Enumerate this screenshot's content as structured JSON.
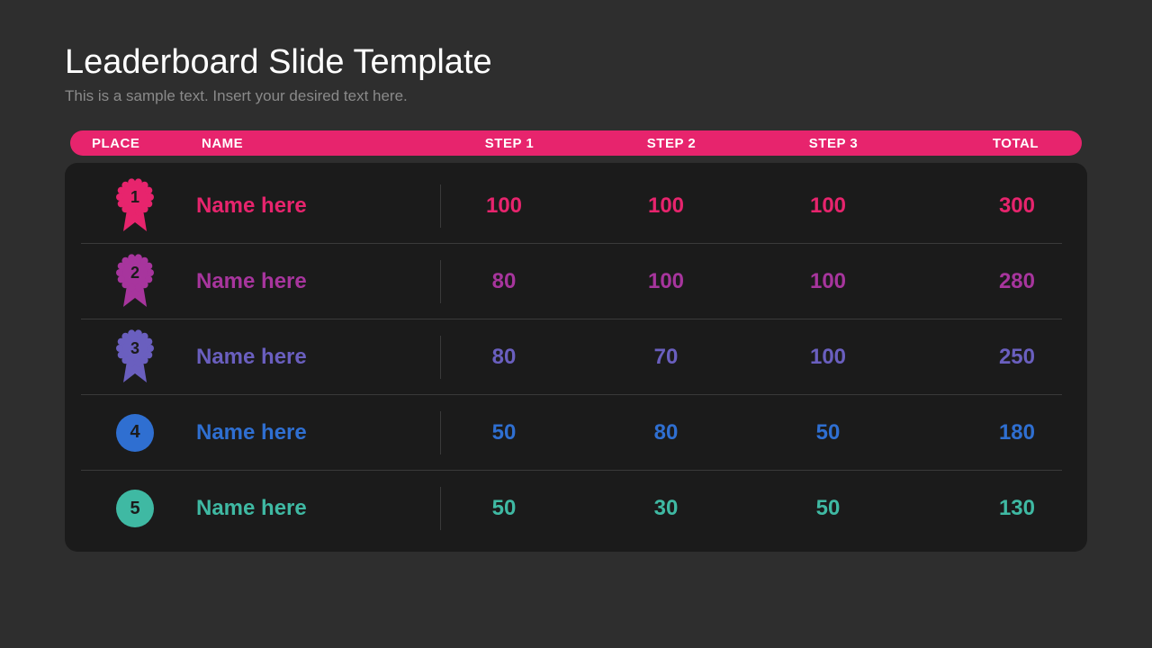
{
  "title": "Leaderboard Slide Template",
  "subtitle": "This is a sample text. Insert your desired text here.",
  "columns": {
    "place": "PLACE",
    "name": "NAME",
    "step1": "STEP 1",
    "step2": "STEP 2",
    "step3": "STEP 3",
    "total": "TOTAL"
  },
  "rows": [
    {
      "place": "1",
      "badge": "ribbon",
      "color": "#e7246d",
      "name": "Name here",
      "step1": "100",
      "step2": "100",
      "step3": "100",
      "total": "300"
    },
    {
      "place": "2",
      "badge": "ribbon",
      "color": "#a7359d",
      "name": "Name here",
      "step1": "80",
      "step2": "100",
      "step3": "100",
      "total": "280"
    },
    {
      "place": "3",
      "badge": "ribbon",
      "color": "#6a5fbf",
      "name": "Name here",
      "step1": "80",
      "step2": "70",
      "step3": "100",
      "total": "250"
    },
    {
      "place": "4",
      "badge": "circle",
      "color": "#2f6fd1",
      "name": "Name here",
      "step1": "50",
      "step2": "80",
      "step3": "50",
      "total": "180"
    },
    {
      "place": "5",
      "badge": "circle",
      "color": "#3fb9a3",
      "name": "Name here",
      "step1": "50",
      "step2": "30",
      "step3": "50",
      "total": "130"
    }
  ]
}
